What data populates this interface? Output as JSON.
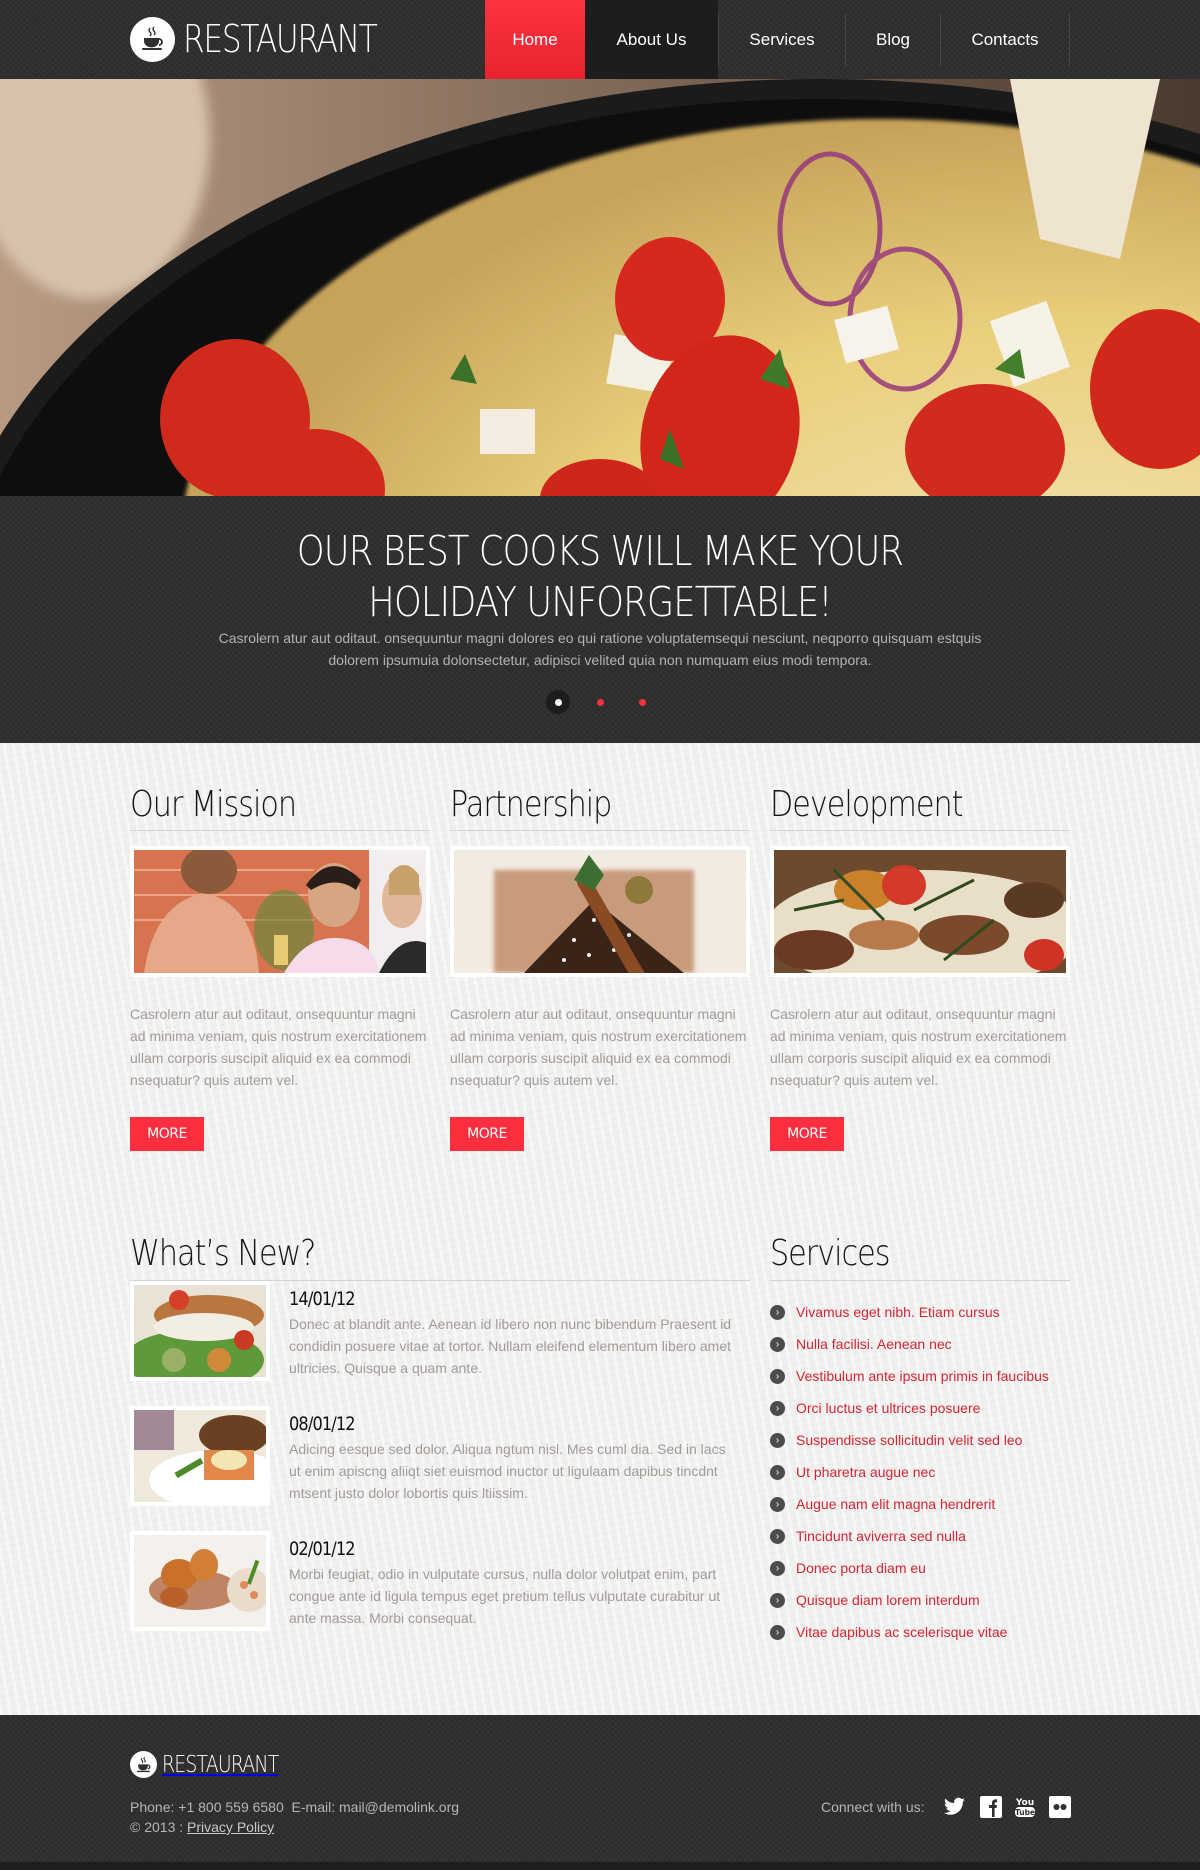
{
  "header": {
    "logo_text": "RESTAURANT",
    "nav": [
      {
        "label": "Home",
        "state": "active"
      },
      {
        "label": "About Us",
        "state": "hover"
      },
      {
        "label": "Services",
        "state": "normal"
      },
      {
        "label": "Blog",
        "state": "normal"
      },
      {
        "label": "Contacts",
        "state": "normal"
      }
    ]
  },
  "hero": {
    "title_line1": "OUR BEST COOKS WILL MAKE YOUR",
    "title_line2": "HOLIDAY UNFORGETTABLE!",
    "text": "Casrolern atur aut oditaut. onsequuntur magni dolores eo qui ratione voluptatemsequi nesciunt, neqporro quisquam estquis dolorem ipsumuia dolonsectetur, adipisci velited quia non numquam eius modi tempora.",
    "slides_count": 3,
    "active_slide": 1
  },
  "features": [
    {
      "title": "Our Mission",
      "image": "couple-toasting-photo",
      "text": "Casrolern atur aut oditaut, onsequuntur magni ad minima veniam, quis nostrum exercitationem ullam corporis suscipit aliquid ex ea commodi nsequatur? quis autem vel.",
      "button": "MORE"
    },
    {
      "title": "Partnership",
      "image": "chocolate-dessert-photo",
      "text": "Casrolern atur aut oditaut, onsequuntur magni ad minima veniam, quis nostrum exercitationem ullam corporis suscipit aliquid ex ea commodi nsequatur? quis autem vel.",
      "button": "MORE"
    },
    {
      "title": "Development",
      "image": "mushroom-dish-photo",
      "text": "Casrolern atur aut oditaut, onsequuntur magni ad minima veniam, quis nostrum exercitationem ullam corporis suscipit aliquid ex ea commodi nsequatur? quis autem vel.",
      "button": "MORE"
    }
  ],
  "news": {
    "title": "What’s New?",
    "items": [
      {
        "date": "14/01/12",
        "image": "fish-salad-photo",
        "text": "Donec at blandit ante. Aenean id libero non nunc bibendum Praesent id condidin posuere vitae at tortor. Nullam eleifend elementum libero amet ultricies. Quisque a quam ante."
      },
      {
        "date": "08/01/12",
        "image": "grilled-meat-plate-photo",
        "text": "Adicing eesque sed dolor. Aliqua ngtum nisl. Mes cuml dia. Sed in lacs ut enim apiscng aliiqt siet euismod inuctor ut ligulaam dapibus tincdnt mtsent justo dolor lobortis quis ltiissim."
      },
      {
        "date": "02/01/12",
        "image": "shrimp-plate-photo",
        "text": "Morbi feugiat, odio in vulputate cursus, nulla dolor volutpat enim, part congue ante id ligula tempus eget pretium tellus vulputate curabitur ut ante massa. Morbi consequat."
      }
    ]
  },
  "services": {
    "title": "Services",
    "items": [
      "Vivamus eget nibh. Etiam cursus",
      "Nulla facilisi. Aenean nec",
      "Vestibulum ante ipsum primis in faucibus",
      "Orci luctus et ultrices posuere",
      "Suspendisse sollicitudin velit sed leo",
      "Ut pharetra augue nec",
      "Augue nam elit magna hendrerit",
      "Tincidunt aviverra sed nulla",
      "Donec porta diam eu",
      "Quisque diam lorem interdum",
      "Vitae dapibus ac scelerisque vitae"
    ]
  },
  "footer": {
    "logo_text": "RESTAURANT",
    "phone_label": "Phone:",
    "phone": "+1 800 559 6580",
    "email_label": "E-mail:",
    "email": "mail@demolink.org",
    "copyright": "© 2013 :",
    "privacy_link": "Privacy Policy",
    "connect_label": "Connect with us:",
    "social": [
      {
        "name": "twitter-icon"
      },
      {
        "name": "facebook-icon"
      },
      {
        "name": "youtube-icon"
      },
      {
        "name": "flickr-icon"
      }
    ]
  },
  "colors": {
    "accent": "#fd2f3f",
    "service_link": "#d52433",
    "dark_bg": "#2f2f2f",
    "body_text": "#a39a9a"
  }
}
